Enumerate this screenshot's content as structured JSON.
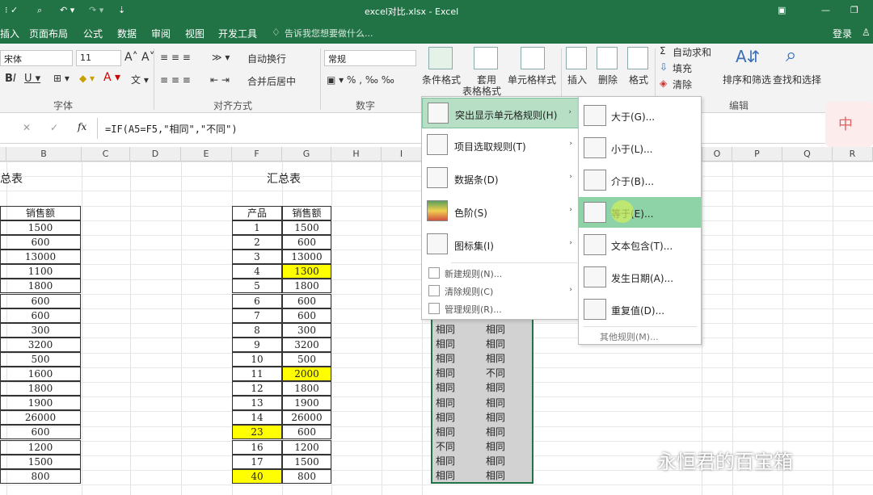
{
  "window": {
    "title": "excel对比.xlsx - Excel"
  },
  "menu": [
    "插入",
    "页面布局",
    "公式",
    "数据",
    "审阅",
    "视图",
    "开发工具"
  ],
  "tell_me": "告诉我您想要做什么...",
  "login": "登录",
  "ribbon": {
    "font_name": "宋体",
    "font_size": "11",
    "wrap_text": "自动换行",
    "merge_center": "合并后居中",
    "number_format": "常规",
    "cond_format": "条件格式",
    "table_format_1": "套用",
    "table_format_2": "表格格式",
    "cell_style": "单元格样式",
    "insert": "插入",
    "delete": "删除",
    "format": "格式",
    "autosum": "自动求和",
    "fill": "填充",
    "clear": "清除",
    "sort_filter": "排序和筛选",
    "find_select": "查找和选择",
    "group_font": "字体",
    "group_align": "对齐方式",
    "group_number": "数字",
    "group_edit": "编辑"
  },
  "formula": "=IF(A5=F5,\"相同\",\"不同\")",
  "columns": [
    "B",
    "C",
    "D",
    "E",
    "F",
    "G",
    "H",
    "I",
    "O",
    "P",
    "Q",
    "R"
  ],
  "left_table": {
    "title": "总表",
    "header": "销售额",
    "values": [
      "1500",
      "600",
      "13000",
      "1100",
      "1800",
      "600",
      "600",
      "300",
      "3200",
      "500",
      "1600",
      "1800",
      "1900",
      "26000",
      "600",
      "1200",
      "1500",
      "800"
    ]
  },
  "right_table": {
    "title": "汇总表",
    "header_product": "产品",
    "header_sales": "销售额",
    "products": [
      "1",
      "2",
      "3",
      "4",
      "5",
      "6",
      "7",
      "8",
      "9",
      "10",
      "11",
      "12",
      "13",
      "14",
      "23",
      "16",
      "17",
      "40"
    ],
    "sales": [
      "1500",
      "600",
      "13000",
      "1300",
      "1800",
      "600",
      "600",
      "300",
      "3200",
      "500",
      "2000",
      "1800",
      "1900",
      "26000",
      "600",
      "1200",
      "1500",
      "800"
    ],
    "highlight_color": "#ffff00"
  },
  "compare": {
    "col1": [
      "相同",
      "相同",
      "相同",
      "相同",
      "相同",
      "相同",
      "相同",
      "相同",
      "不同",
      "相同",
      "相同"
    ],
    "col2": [
      "相同",
      "相同",
      "相同",
      "不同",
      "相同",
      "相同",
      "相同",
      "相同",
      "相同",
      "相同",
      "相同"
    ]
  },
  "cf_menu": {
    "items": [
      {
        "label": "突出显示单元格规则(H)",
        "arrow": "›"
      },
      {
        "label": "项目选取规则(T)",
        "arrow": "›"
      },
      {
        "label": "数据条(D)",
        "arrow": "›"
      },
      {
        "label": "色阶(S)",
        "arrow": "›"
      },
      {
        "label": "图标集(I)",
        "arrow": "›"
      }
    ],
    "small_items": [
      "新建规则(N)...",
      "清除规则(C)",
      "管理规则(R)..."
    ]
  },
  "sub_menu": {
    "items": [
      "大于(G)...",
      "小于(L)...",
      "介于(B)...",
      "等于(E)...",
      "文本包含(T)...",
      "发生日期(A)...",
      "重复值(D)..."
    ],
    "more": "其他规则(M)..."
  },
  "ime_badge": "中",
  "watermark": "永恒君的百宝箱",
  "colors": {
    "excel_green": "#217346",
    "menu_hover": "#8dd3a7",
    "menu_selected": "#b7dfc5"
  }
}
